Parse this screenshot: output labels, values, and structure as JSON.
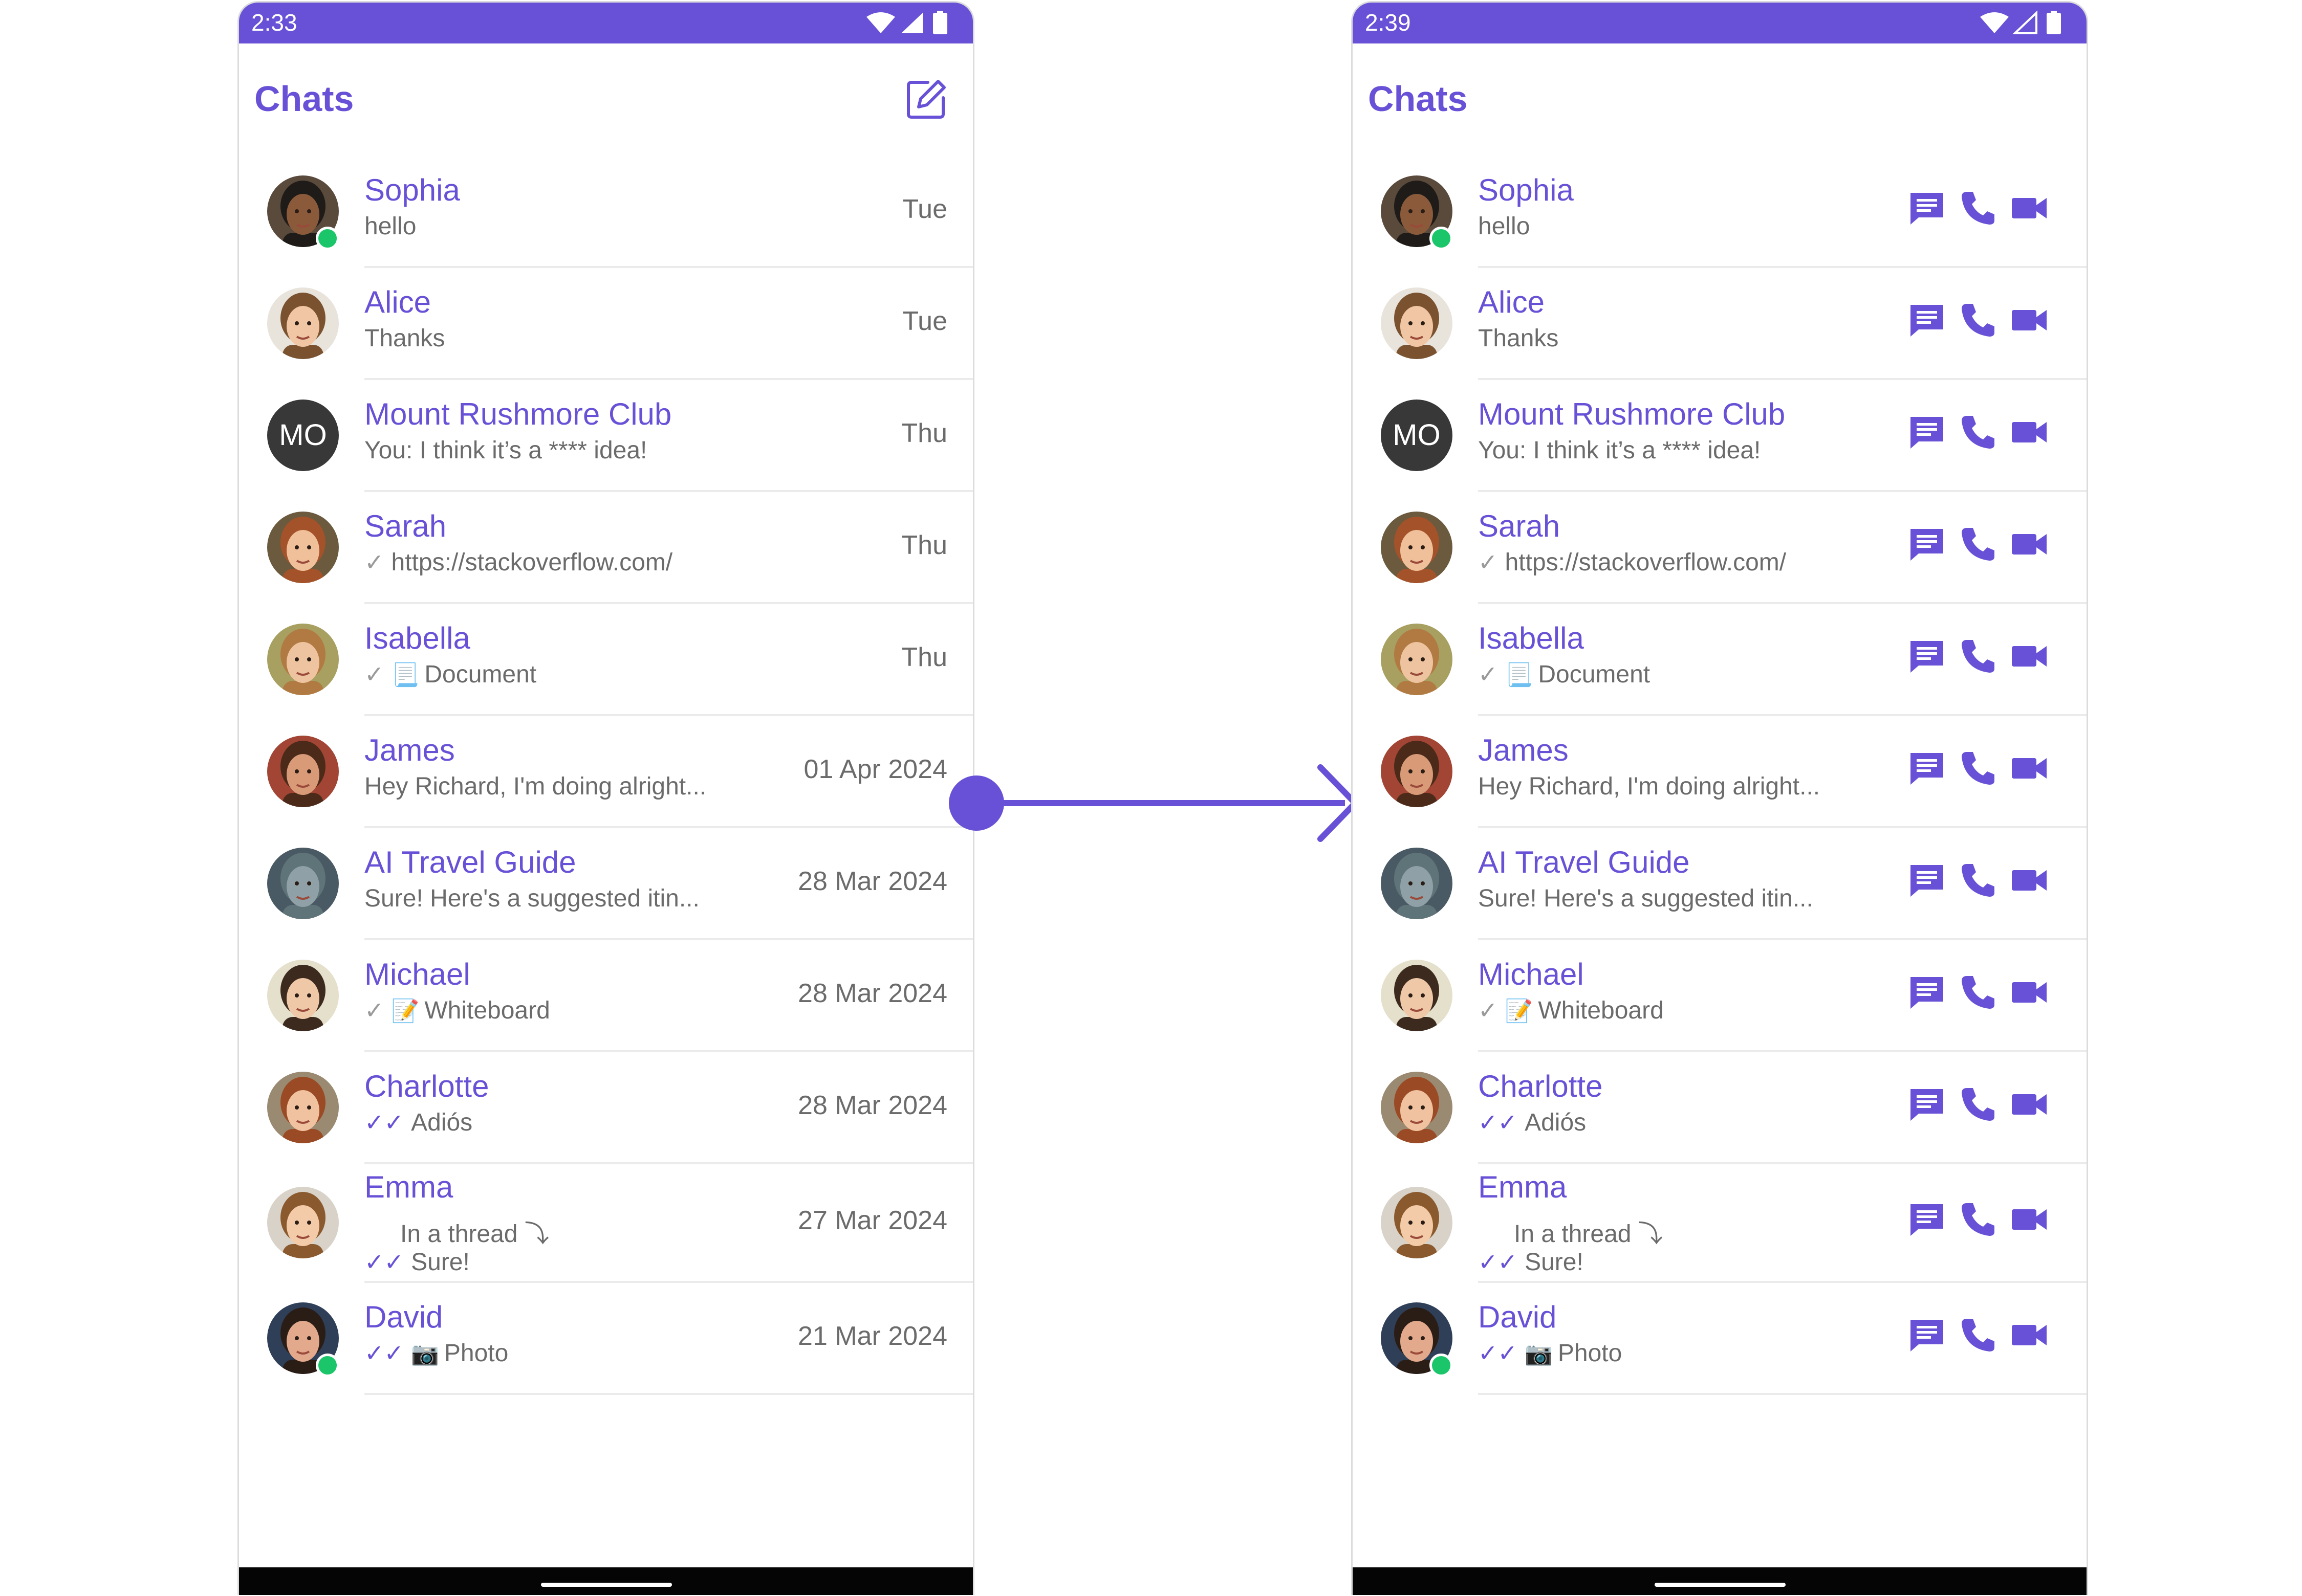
{
  "colors": {
    "accent": "#6851d6",
    "status_bar": "#6851d6",
    "online": "#1bc56a",
    "divider": "#ebebeb",
    "subtitle": "#6b6b6b"
  },
  "screens": [
    {
      "status_time": "2:33",
      "title": "Chats",
      "header_action": "compose-icon",
      "conversations": [
        {
          "name": "Sophia",
          "preview": "hello",
          "time": "Tue",
          "online": true
        },
        {
          "name": "Alice",
          "preview": "Thanks",
          "time": "Tue"
        },
        {
          "name": "Mount Rushmore Club",
          "initials": "MO",
          "preview": "You: I think it’s a **** idea!",
          "time": "Thu"
        },
        {
          "name": "Sarah",
          "tick": "✓",
          "preview": "https://stackoverflow.com/",
          "time": "Thu"
        },
        {
          "name": "Isabella",
          "tick": "✓",
          "emoji": "📃",
          "preview": "Document",
          "time": "Thu"
        },
        {
          "name": "James",
          "preview": "Hey Richard, I'm doing alright...",
          "time": "01 Apr 2024"
        },
        {
          "name": "AI Travel Guide",
          "preview": "Sure! Here's a suggested itin...",
          "time": "28 Mar 2024"
        },
        {
          "name": "Michael",
          "tick": "✓",
          "emoji": "📝",
          "preview": "Whiteboard",
          "time": "28 Mar 2024"
        },
        {
          "name": "Charlotte",
          "tick": "✓✓",
          "preview": "Adiós",
          "time": "28 Mar 2024"
        },
        {
          "name": "Emma",
          "thread_label": "In a thread ⤵",
          "tick": "✓✓",
          "preview": "Sure!",
          "time": "27 Mar 2024"
        },
        {
          "name": "David",
          "tick": "✓✓",
          "emoji": "📷",
          "preview": "Photo",
          "time": "21 Mar 2024",
          "online": true
        }
      ]
    },
    {
      "status_time": "2:39",
      "title": "Chats",
      "row_actions": [
        "message-icon",
        "voice-call-icon",
        "video-call-icon"
      ],
      "conversations": [
        {
          "name": "Sophia",
          "preview": "hello",
          "online": true
        },
        {
          "name": "Alice",
          "preview": "Thanks"
        },
        {
          "name": "Mount Rushmore Club",
          "initials": "MO",
          "preview": "You: I think it’s a **** idea!"
        },
        {
          "name": "Sarah",
          "tick": "✓",
          "preview": "https://stackoverflow.com/"
        },
        {
          "name": "Isabella",
          "tick": "✓",
          "emoji": "📃",
          "preview": "Document"
        },
        {
          "name": "James",
          "preview": "Hey Richard, I'm doing alright..."
        },
        {
          "name": "AI Travel Guide",
          "preview": "Sure! Here's a suggested itin..."
        },
        {
          "name": "Michael",
          "tick": "✓",
          "emoji": "📝",
          "preview": "Whiteboard"
        },
        {
          "name": "Charlotte",
          "tick": "✓✓",
          "preview": "Adiós"
        },
        {
          "name": "Emma",
          "thread_label": "In a thread ⤵",
          "tick": "✓✓",
          "preview": "Sure!"
        },
        {
          "name": "David",
          "tick": "✓✓",
          "emoji": "📷",
          "preview": "Photo",
          "online": true
        }
      ]
    }
  ]
}
